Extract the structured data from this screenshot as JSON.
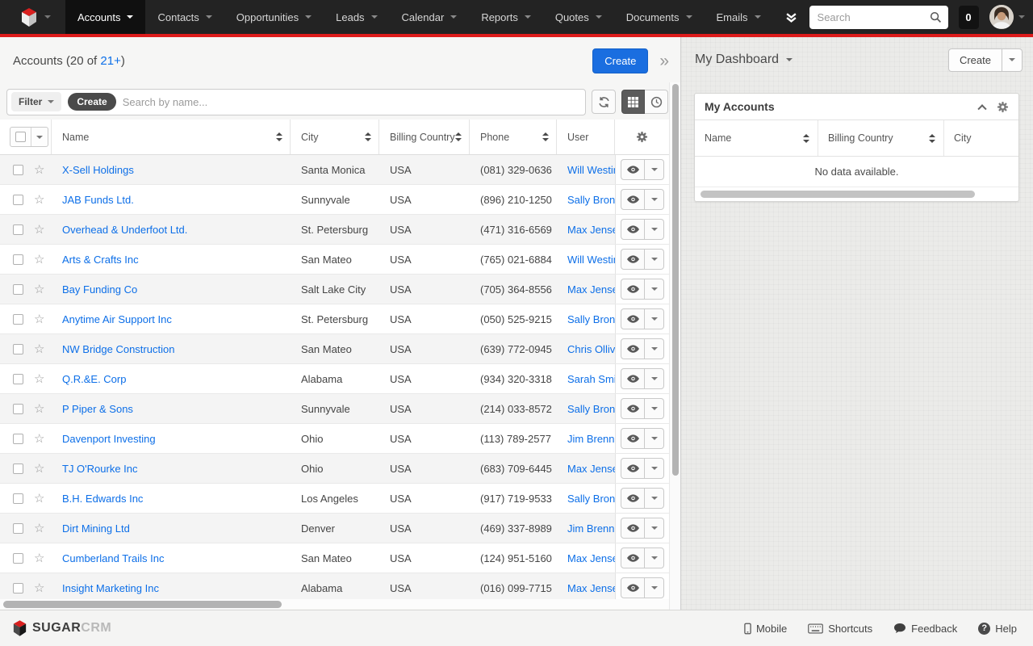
{
  "navbar": {
    "items": [
      {
        "label": "Accounts",
        "active": true
      },
      {
        "label": "Contacts",
        "active": false
      },
      {
        "label": "Opportunities",
        "active": false
      },
      {
        "label": "Leads",
        "active": false
      },
      {
        "label": "Calendar",
        "active": false
      },
      {
        "label": "Reports",
        "active": false
      },
      {
        "label": "Quotes",
        "active": false
      },
      {
        "label": "Documents",
        "active": false
      },
      {
        "label": "Emails",
        "active": false
      }
    ],
    "search_placeholder": "Search",
    "notification_count": "0"
  },
  "list_header": {
    "title_open": "Accounts (20 of ",
    "count_link": "21+",
    "title_close": ")",
    "create_label": "Create"
  },
  "toolbar": {
    "filter_label": "Filter",
    "create_pill_label": "Create",
    "search_placeholder": "Search by name..."
  },
  "table": {
    "columns": {
      "name": "Name",
      "city": "City",
      "country": "Billing Country",
      "phone": "Phone",
      "user": "User"
    },
    "rows": [
      {
        "name": "X-Sell Holdings",
        "city": "Santa Monica",
        "country": "USA",
        "phone": "(081) 329-0636",
        "user": "Will Westin"
      },
      {
        "name": "JAB Funds Ltd.",
        "city": "Sunnyvale",
        "country": "USA",
        "phone": "(896) 210-1250",
        "user": "Sally Brons"
      },
      {
        "name": "Overhead & Underfoot Ltd.",
        "city": "St. Petersburg",
        "country": "USA",
        "phone": "(471) 316-6569",
        "user": "Max Jense"
      },
      {
        "name": "Arts & Crafts Inc",
        "city": "San Mateo",
        "country": "USA",
        "phone": "(765) 021-6884",
        "user": "Will Westin"
      },
      {
        "name": "Bay Funding Co",
        "city": "Salt Lake City",
        "country": "USA",
        "phone": "(705) 364-8556",
        "user": "Max Jense"
      },
      {
        "name": "Anytime Air Support Inc",
        "city": "St. Petersburg",
        "country": "USA",
        "phone": "(050) 525-9215",
        "user": "Sally Brons"
      },
      {
        "name": "NW Bridge Construction",
        "city": "San Mateo",
        "country": "USA",
        "phone": "(639) 772-0945",
        "user": "Chris Ollive"
      },
      {
        "name": "Q.R.&E. Corp",
        "city": "Alabama",
        "country": "USA",
        "phone": "(934) 320-3318",
        "user": "Sarah Smit"
      },
      {
        "name": "P Piper & Sons",
        "city": "Sunnyvale",
        "country": "USA",
        "phone": "(214) 033-8572",
        "user": "Sally Brons"
      },
      {
        "name": "Davenport Investing",
        "city": "Ohio",
        "country": "USA",
        "phone": "(113) 789-2577",
        "user": "Jim Brenna"
      },
      {
        "name": "TJ O'Rourke Inc",
        "city": "Ohio",
        "country": "USA",
        "phone": "(683) 709-6445",
        "user": "Max Jense"
      },
      {
        "name": "B.H. Edwards Inc",
        "city": "Los Angeles",
        "country": "USA",
        "phone": "(917) 719-9533",
        "user": "Sally Brons"
      },
      {
        "name": "Dirt Mining Ltd",
        "city": "Denver",
        "country": "USA",
        "phone": "(469) 337-8989",
        "user": "Jim Brenna"
      },
      {
        "name": "Cumberland Trails Inc",
        "city": "San Mateo",
        "country": "USA",
        "phone": "(124) 951-5160",
        "user": "Max Jense"
      },
      {
        "name": "Insight Marketing Inc",
        "city": "Alabama",
        "country": "USA",
        "phone": "(016) 099-7715",
        "user": "Max Jense"
      }
    ]
  },
  "dashboard": {
    "title": "My Dashboard",
    "create_label": "Create",
    "dashlet": {
      "title": "My Accounts",
      "columns": {
        "name": "Name",
        "country": "Billing Country",
        "city": "City"
      },
      "empty_text": "No data available."
    }
  },
  "footer": {
    "brand_bold": "SUGAR",
    "brand_light": "CRM",
    "links": [
      "Mobile",
      "Shortcuts",
      "Feedback",
      "Help"
    ]
  },
  "colors": {
    "accent_red": "#dd1b1b",
    "link_blue": "#0d6fe8",
    "primary_button": "#1a6ee0",
    "navbar_bg": "#232323"
  }
}
